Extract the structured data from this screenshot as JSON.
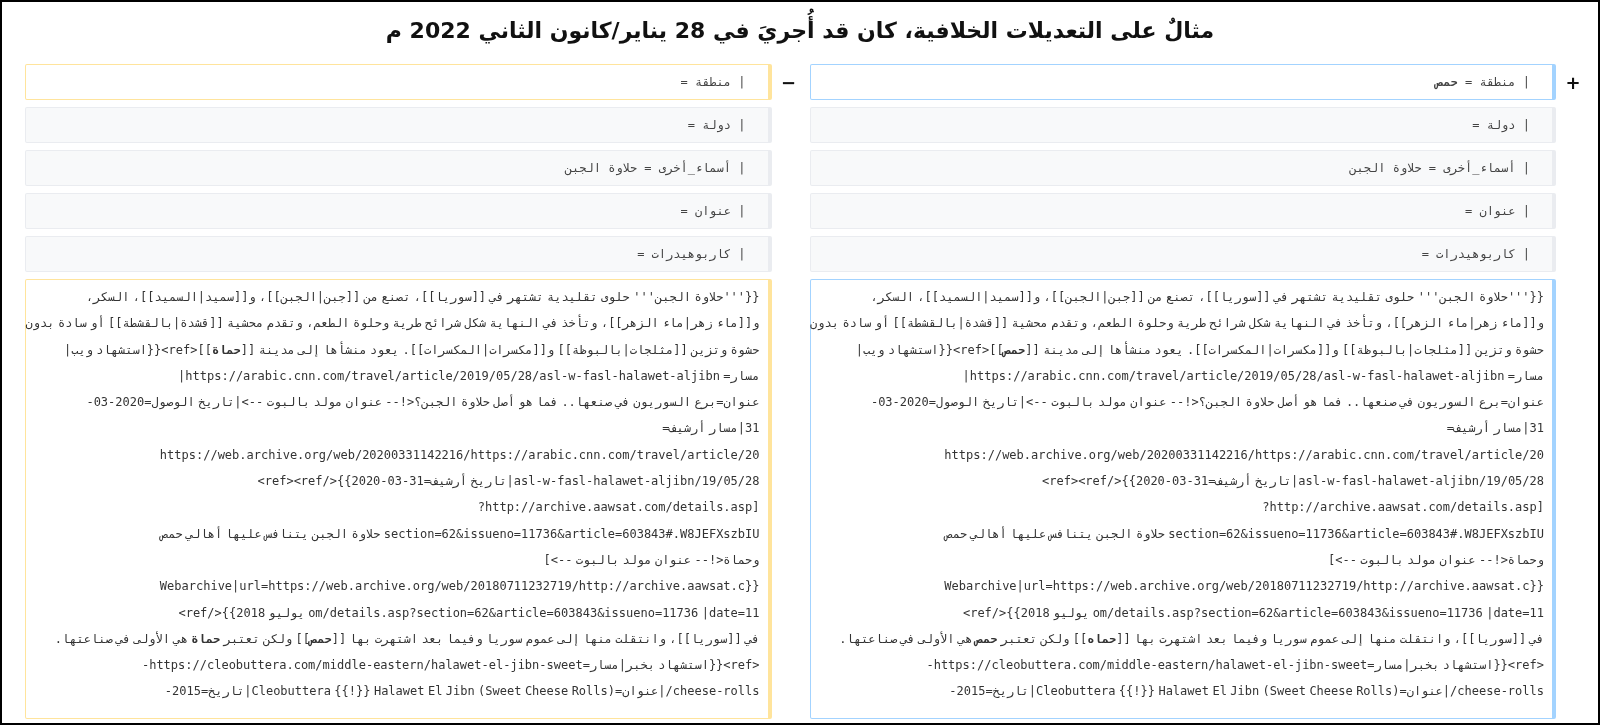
{
  "title": "مثالٌ على التعديلات الخلافية، كان قد أُجريَ في 28 يناير/كانون الثاني 2022 م",
  "panes": [
    {
      "kind": "added",
      "marker": "+",
      "rows": [
        {
          "kind": "changed",
          "lines": [
            "| منطقة = **حمص**"
          ]
        },
        {
          "kind": "context",
          "lines": [
            "| دولة ="
          ]
        },
        {
          "kind": "context",
          "lines": [
            "| أسماء_أخرى = حلاوة الجبن"
          ]
        },
        {
          "kind": "context",
          "lines": [
            "| عنوان ="
          ]
        },
        {
          "kind": "context",
          "lines": [
            "| كاربوهيدرات ="
          ]
        },
        {
          "kind": "changed",
          "lines": [
            "{{'''حلاوة الجبن''' حلوى تقليدية تشتهر في [[سوريا]]، تصنع من [[جبن|الجبن]]، و[[سميد|السميد]]، السكر،",
            "و[[ماء زهر|ماء الزهر]]، وتأخذ في النهاية شكل شرائح طرية وحلوة الطعم، وتقدم محشية [[قشدة|بالقشطة]] أو سادة بدون",
            "حشوة وتزين [[مثلجات|بالبوظة]] و[[مكسرات|المكسرات]]. يعود منشأها إلى مدينة [[**حمص**]]<ref>{{استشهاد ويب|",
            "مسار= https://arabic.cnn.com/travel/article/2019/05/28/asl-w-fasl-halawet-aljibn|",
            "عنوان=برع السوريون في صنعها.. فما هو أصل حلاوة الجبن؟<!-- عنوان مولد بالبوت -->|تاريخ الوصول=2020-03-",
            "31|مسار أرشيف=",
            "https://web.archive.org/web/20200331142216/https://arabic.cnn.com/travel/article/20",
            "19/05/28/asl-w-fasl-halawet-aljibn|تاريخ أرشيف=31-03-2020}}</ref><ref>",
            "[http://archive.aawsat.com/details.asp?",
            "section=62&issueno=11736&article=603843#.W8JEFXszbIU حلاوة الجبن يتنافس عليها أهالي حمص",
            "وحماة<!-- عنوان مولد بالبوت -->]",
            "{{Webarchive|url=https://web.archive.org/web/20180711232719/http://archive.aawsat.c",
            "om/details.asp?section=62&article=603843&issueno=11736 |date=11 يوليو 2018}}</ref>",
            "في [[سوريا]]، وانتقلت منها إلى عموم سوريا وفيما بعد اشتهرت بها [[**حماه**]] ولكن تعتبر **حمص** هي الأولى في صناعتها.",
            "<ref>{{استشهاد بخبر|مسار=https://cleobuttera.com/middle-eastern/halawet-el-jibn-sweet-",
            "cheese-rolls/|عنوان=Cleobuttera {{!}} Halawet El Jibn (Sweet Cheese Rolls)|تاريخ=2015-"
          ]
        }
      ]
    },
    {
      "kind": "removed",
      "marker": "−",
      "rows": [
        {
          "kind": "changed",
          "lines": [
            "| منطقة ="
          ]
        },
        {
          "kind": "context",
          "lines": [
            "| دولة ="
          ]
        },
        {
          "kind": "context",
          "lines": [
            "| أسماء_أخرى = حلاوة الجبن"
          ]
        },
        {
          "kind": "context",
          "lines": [
            "| عنوان ="
          ]
        },
        {
          "kind": "context",
          "lines": [
            "| كاربوهيدرات ="
          ]
        },
        {
          "kind": "changed",
          "lines": [
            "{{'''حلاوة الجبن''' حلوى تقليدية تشتهر في [[سوريا]]، تصنع من [[جبن|الجبن]]، و[[سميد|السميد]]، السكر،",
            "و[[ماء زهر|ماء الزهر]]، وتأخذ في النهاية شكل شرائح طرية وحلوة الطعم، وتقدم محشية [[قشدة|بالقشطة]] أو سادة بدون",
            "حشوة وتزين [[مثلجات|بالبوظة]] و[[مكسرات|المكسرات]]. يعود منشأها إلى مدينة [[**حماة**]]<ref>{{استشهاد ويب|",
            "مسار= https://arabic.cnn.com/travel/article/2019/05/28/asl-w-fasl-halawet-aljibn|",
            "عنوان=برع السوريون في صنعها.. فما هو أصل حلاوة الجبن؟<!-- عنوان مولد بالبوت -->|تاريخ الوصول=2020-03-",
            "31|مسار أرشيف=",
            "https://web.archive.org/web/20200331142216/https://arabic.cnn.com/travel/article/20",
            "19/05/28/asl-w-fasl-halawet-aljibn|تاريخ أرشيف=31-03-2020}}</ref><ref>",
            "[http://archive.aawsat.com/details.asp?",
            "section=62&issueno=11736&article=603843#.W8JEFXszbIU حلاوة الجبن يتنافس عليها أهالي حمص",
            "وحماة<!-- عنوان مولد بالبوت -->]",
            "{{Webarchive|url=https://web.archive.org/web/20180711232719/http://archive.aawsat.c",
            "om/details.asp?section=62&article=603843&issueno=11736 |date=11 يوليو 2018}}</ref>",
            "في [[سوريا]]، وانتقلت منها إلى عموم سوريا وفيما بعد اشتهرت بها [[**حمص**]] ولكن تعتبر **حماة** هي الأولى في صناعتها.",
            "<ref>{{استشهاد بخبر|مسار=https://cleobuttera.com/middle-eastern/halawet-el-jibn-sweet-",
            "cheese-rolls/|عنوان=Cleobuttera {{!}} Halawet El Jibn (Sweet Cheese Rolls)|تاريخ=2015-"
          ]
        }
      ]
    }
  ]
}
